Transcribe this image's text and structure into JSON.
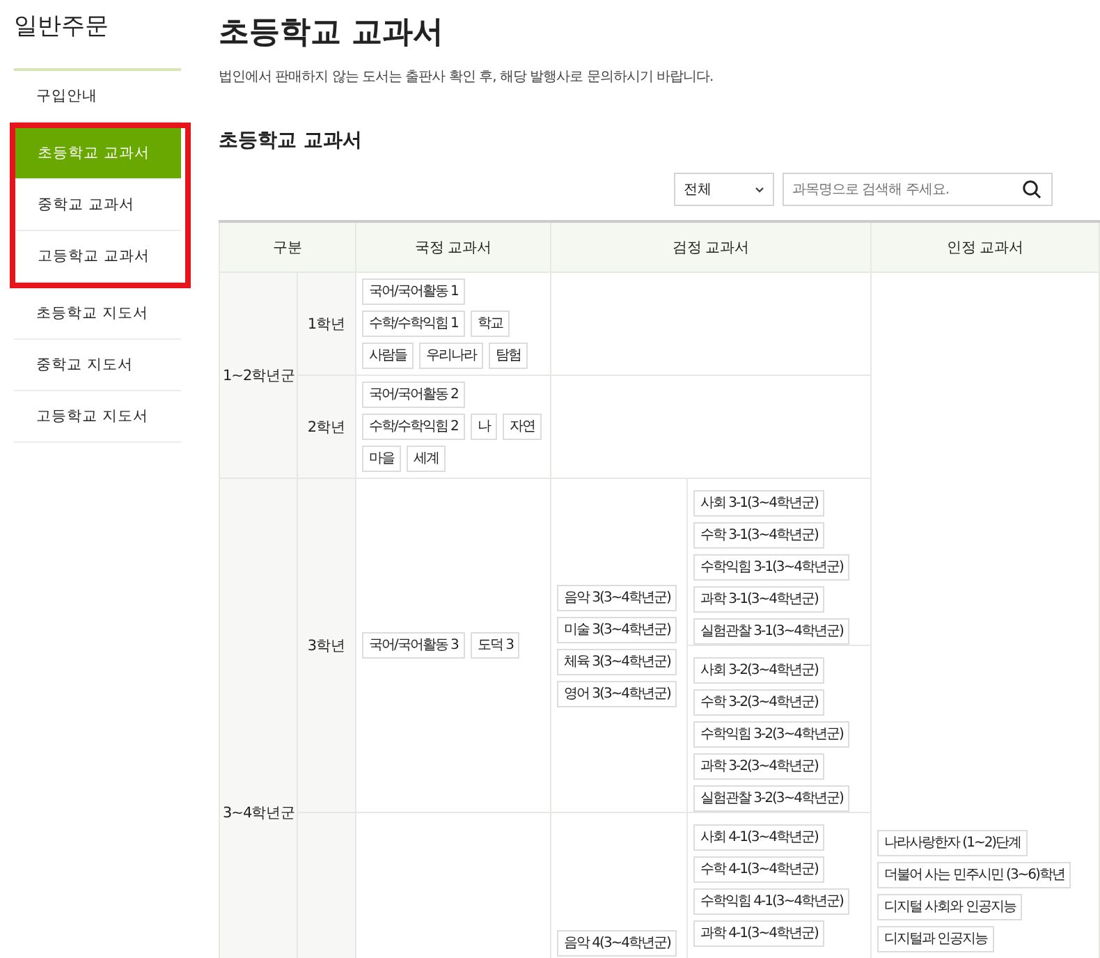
{
  "sidebar": {
    "title": "일반주문",
    "items": [
      {
        "label": "구입안내",
        "selected": false,
        "marked": false
      },
      {
        "label": "초등학교 교과서",
        "selected": true,
        "marked": true
      },
      {
        "label": "중학교 교과서",
        "selected": false,
        "marked": true
      },
      {
        "label": "고등학교 교과서",
        "selected": false,
        "marked": true
      },
      {
        "label": "초등학교 지도서",
        "selected": false,
        "marked": false
      },
      {
        "label": "중학교 지도서",
        "selected": false,
        "marked": false
      },
      {
        "label": "고등학교 지도서",
        "selected": false,
        "marked": false
      }
    ]
  },
  "page": {
    "title": "초등학교 교과서",
    "notice": "법인에서 판매하지 않는 도서는 출판사 확인 후, 해당 발행사로 문의하시기 바랍니다.",
    "section_title": "초등학교 교과서"
  },
  "filter": {
    "value": "전체"
  },
  "search": {
    "placeholder": "과목명으로 검색해 주세요."
  },
  "table": {
    "columns": [
      "구분",
      "국정 교과서",
      "검정 교과서",
      "인정 교과서"
    ],
    "groups": [
      {
        "label": "1~2학년군",
        "grades": [
          {
            "label": "1학년",
            "national": [
              "국어/국어활동 1",
              "수학/수학익힘 1",
              "학교",
              "사람들",
              "우리나라",
              "탐험"
            ]
          },
          {
            "label": "2학년",
            "national": [
              "국어/국어활동 2",
              "수학/수학익힘 2",
              "나",
              "자연",
              "마을",
              "세계"
            ]
          }
        ]
      },
      {
        "label": "3~4학년군",
        "grades": [
          {
            "label": "3학년",
            "national": [
              "국어/국어활동 3",
              "도덕 3"
            ],
            "authorized": [
              "음악 3(3~4학년군)",
              "미술 3(3~4학년군)",
              "체육 3(3~4학년군)",
              "영어 3(3~4학년군)"
            ],
            "semesters": [
              [
                "사회 3-1(3~4학년군)",
                "수학 3-1(3~4학년군)",
                "수학익힘 3-1(3~4학년군)",
                "과학 3-1(3~4학년군)",
                "실험관찰 3-1(3~4학년군)"
              ],
              [
                "사회 3-2(3~4학년군)",
                "수학 3-2(3~4학년군)",
                "수학익힘 3-2(3~4학년군)",
                "과학 3-2(3~4학년군)",
                "실험관찰 3-2(3~4학년군)"
              ]
            ]
          },
          {
            "authorized": [
              "음악 4(3~4학년군)"
            ],
            "semesters": [
              [
                "사회 4-1(3~4학년군)",
                "수학 4-1(3~4학년군)",
                "수학익힘 4-1(3~4학년군)",
                "과학 4-1(3~4학년군)"
              ]
            ]
          }
        ]
      }
    ],
    "approved": [
      "나라사랑한자 (1~2)단계",
      "더불어 사는 민주시민 (3~6)학년",
      "디지털 사회와 인공지능",
      "디지털과 인공지능"
    ]
  }
}
